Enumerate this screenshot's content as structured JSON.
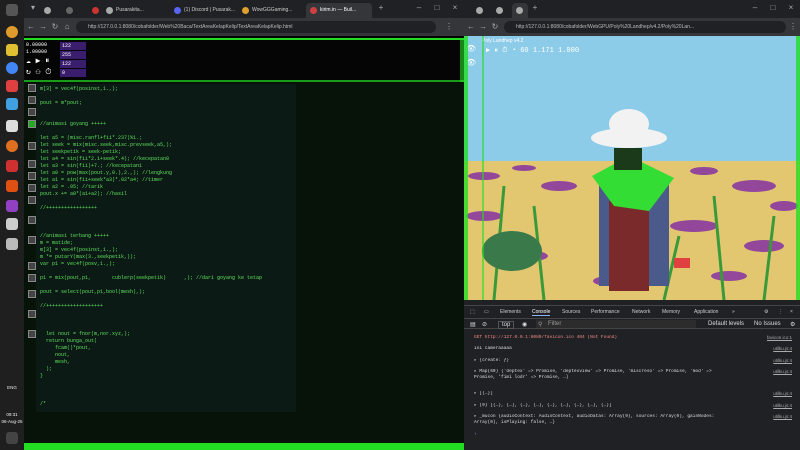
{
  "taskbar": {
    "time": "09:31",
    "date": "06-Aug-25",
    "lang": "ENG"
  },
  "left_browser": {
    "tabs": [
      {
        "label": "Pusarakita..."
      },
      {
        "label": "(1) Discord | Pusarak..."
      },
      {
        "label": "WowGGGaming..."
      },
      {
        "label": "kirim.in — Buil..."
      }
    ],
    "address": "http://127.0.0.1:8080/cobafolder/Web%20Baca/TextAreaKelapKelip/TextAreaKelapKelip.html",
    "stats": {
      "line1": "0.00000",
      "line2": "1.00000",
      "box1": "122",
      "box2": "255",
      "box3": "122",
      "box4": "0"
    },
    "code": [
      "m[3] = vec4f(posinst,1.,);",
      "",
      "pout = m*pout;",
      "",
      "",
      "//animasi goyang +++++",
      "",
      "let a5 = (misc.ranfl+fii*.237)%1.;",
      "let seek = mix(misc.seek,misc.prevseek,a5,);",
      "let seekpetik = seek-petik;",
      "let a4 = sin(fii*2.1+seek*.4); //kecepatan0",
      "let a3 = sin(fii)+7.; //kecepatan1",
      "let a0 = pow(max(pout.y,0.),2.,); //lengkung",
      "let a1 = sin(fii+seek*a3)*.02*a4; //timer",
      "let a2 = .05; //tarik",
      "pout.x += a0*(a1+a2); //hasil",
      "",
      "//+++++++++++++++++",
      "",
      "",
      "",
      "//animasi terbang +++++",
      "m = matide;",
      "m[3] = vec4f(posinst,1.,);",
      "m *= putarY(max(3.,seekpetik,));",
      "var p1 = vec4f(posv,1.,);",
      "",
      "p1 = mix(pout,p1,       cublerp(seekpetik)      ,); //dari goyang ke tetap",
      "",
      "pout = select(pout,p1,bool(mesh),);",
      "",
      "//+++++++++++++++++++",
      "",
      "",
      "",
      "  let nout = fnor(m,nor.xyz,);",
      "  return bunga_out(",
      "     fcam()*pout,",
      "     nout,",
      "     mesh,",
      "  );",
      "}",
      "",
      "",
      "",
      "/*"
    ]
  },
  "right_browser": {
    "address": "http://127.0.0.1:8080/cobafolder/WebGPU/Poly%20Landhep/v4.2/Poly%20Lan...",
    "page_title": "Poly Landhep v4.2",
    "hud": {
      "fps": "60",
      "v1": "1.171",
      "v2": "1.000"
    },
    "devtools_tabs": [
      "Elements",
      "Console",
      "Sources",
      "Performance",
      "Network",
      "Memory",
      "Application"
    ],
    "filter_placeholder": "Filter",
    "top_select": "top",
    "levels": "Default levels",
    "issues": "No Issues",
    "console": [
      {
        "text": "GET http://127.0.0.1:8080/favicon.ico 404 (Not Found)",
        "src": "favicon.ico:1",
        "color": "#f28b82"
      },
      {
        "text": "ini cameraaaaa",
        "src": "utilku.js:4",
        "color": "#dddddd"
      },
      {
        "text": "▸ {create: ƒ}",
        "src": "utilku.js:4",
        "color": "#dddddd"
      },
      {
        "text": "▸ Map(60) {'deptex' => Promise, 'deptexview' => Promise, 'miscreso' => Promise, 'mod' => Promise, 'fimi lodr' => Promise, …}",
        "src": "utilku.js:4",
        "color": "#dddddd"
      },
      {
        "text": "▸ [{…}]",
        "src": "utilku.js:4",
        "color": "#dddddd"
      },
      {
        "text": "▸ (9) [{…}, {…}, {…}, {…}, {…}, {…}, {…}, {…}, {…}]",
        "src": "utilku.js:4",
        "color": "#dddddd"
      },
      {
        "text": "▸ _mucon {audioContext: AudioContext, audioDatas: Array(9), sources: Array(0), gainNodes: Array(0), isPlaying: false, …}",
        "src": "utilku.js:4",
        "color": "#dddddd"
      }
    ]
  }
}
